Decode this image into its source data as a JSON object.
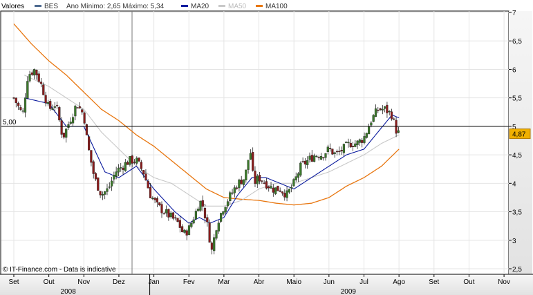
{
  "header": {
    "valores_label": "Valores",
    "symbol": "BES",
    "range_text": "Ano Mínimo: 2,65 Máximo: 5,34",
    "legend": [
      {
        "name": "BES",
        "color": "#4d6a8f"
      },
      {
        "name": "MA20",
        "color": "#0a1a9e"
      },
      {
        "name": "MA50",
        "color": "#c8c8c8"
      },
      {
        "name": "MA100",
        "color": "#e8760f"
      }
    ]
  },
  "footer": {
    "source": "© IT-Finance.com - Data is indicative"
  },
  "chart_data": {
    "type": "candlestick",
    "y_axis": {
      "min": 2.5,
      "max": 7,
      "ticks": [
        "2,5",
        "3",
        "3,5",
        "4",
        "4,5",
        "5",
        "5,5",
        "6",
        "6,5",
        "7"
      ],
      "position": "right"
    },
    "x_axis": {
      "months": [
        "Sep",
        "Oct",
        "Nov",
        "Dec",
        "Jan",
        "Feb",
        "Mar",
        "Apr",
        "May",
        "Jun",
        "Jul",
        "Aug",
        "Sep",
        "Oct",
        "Nov"
      ],
      "month_labels": [
        "Set",
        "Out",
        "Nov",
        "Dez",
        "Jan",
        "Fev",
        "Mar",
        "Abr",
        "Maio",
        "Jun",
        "Jul",
        "Ago",
        "Set",
        "Out",
        "Nov"
      ],
      "year_labels": [
        {
          "text": "2008",
          "month_index": 1
        },
        {
          "text": "2009",
          "month_index": 9
        }
      ]
    },
    "reference_line": {
      "value": 5.0,
      "label": "5,00"
    },
    "last_value": {
      "value": 4.87,
      "label": "4,87"
    },
    "candle_colors": {
      "up": "#3b7a2a",
      "down": "#8a1c1c"
    },
    "price_anchors": [
      [
        0.0,
        5.5
      ],
      [
        0.25,
        5.2
      ],
      [
        0.4,
        5.9
      ],
      [
        0.6,
        6.0
      ],
      [
        0.8,
        5.7
      ],
      [
        1.0,
        5.3
      ],
      [
        1.2,
        5.4
      ],
      [
        1.4,
        4.8
      ],
      [
        1.6,
        5.1
      ],
      [
        1.8,
        5.4
      ],
      [
        2.0,
        5.2
      ],
      [
        2.1,
        4.7
      ],
      [
        2.3,
        4.1
      ],
      [
        2.5,
        3.8
      ],
      [
        2.7,
        3.9
      ],
      [
        2.9,
        4.2
      ],
      [
        3.1,
        4.3
      ],
      [
        3.3,
        4.4
      ],
      [
        3.5,
        4.4
      ],
      [
        3.7,
        4.2
      ],
      [
        3.9,
        3.8
      ],
      [
        4.1,
        3.6
      ],
      [
        4.3,
        3.5
      ],
      [
        4.5,
        3.4
      ],
      [
        4.7,
        3.3
      ],
      [
        4.85,
        3.1
      ],
      [
        5.0,
        3.2
      ],
      [
        5.2,
        3.5
      ],
      [
        5.3,
        3.7
      ],
      [
        5.4,
        3.6
      ],
      [
        5.55,
        3.2
      ],
      [
        5.65,
        2.8
      ],
      [
        5.8,
        3.3
      ],
      [
        6.0,
        3.6
      ],
      [
        6.2,
        3.8
      ],
      [
        6.4,
        4.0
      ],
      [
        6.6,
        4.1
      ],
      [
        6.75,
        4.6
      ],
      [
        6.85,
        4.0
      ],
      [
        7.0,
        4.1
      ],
      [
        7.2,
        4.0
      ],
      [
        7.4,
        3.9
      ],
      [
        7.6,
        3.9
      ],
      [
        7.8,
        3.8
      ],
      [
        8.0,
        4.0
      ],
      [
        8.2,
        4.3
      ],
      [
        8.4,
        4.4
      ],
      [
        8.6,
        4.5
      ],
      [
        8.8,
        4.5
      ],
      [
        9.0,
        4.6
      ],
      [
        9.2,
        4.5
      ],
      [
        9.4,
        4.6
      ],
      [
        9.6,
        4.7
      ],
      [
        9.8,
        4.7
      ],
      [
        10.0,
        4.8
      ],
      [
        10.2,
        5.1
      ],
      [
        10.4,
        5.3
      ],
      [
        10.6,
        5.3
      ],
      [
        10.8,
        5.2
      ],
      [
        10.9,
        4.95
      ],
      [
        11.0,
        4.87
      ]
    ],
    "ma20": [
      [
        0.3,
        5.5
      ],
      [
        1.0,
        5.4
      ],
      [
        1.5,
        5.0
      ],
      [
        2.0,
        5.0
      ],
      [
        2.3,
        4.6
      ],
      [
        2.6,
        4.2
      ],
      [
        3.0,
        4.1
      ],
      [
        3.5,
        4.3
      ],
      [
        4.0,
        3.9
      ],
      [
        4.3,
        3.7
      ],
      [
        4.6,
        3.5
      ],
      [
        5.0,
        3.3
      ],
      [
        5.3,
        3.4
      ],
      [
        5.6,
        3.3
      ],
      [
        6.0,
        3.4
      ],
      [
        6.4,
        3.8
      ],
      [
        6.8,
        4.1
      ],
      [
        7.2,
        4.1
      ],
      [
        7.6,
        4.0
      ],
      [
        8.0,
        3.9
      ],
      [
        8.5,
        4.1
      ],
      [
        9.0,
        4.3
      ],
      [
        9.5,
        4.5
      ],
      [
        10.0,
        4.6
      ],
      [
        10.4,
        4.9
      ],
      [
        10.8,
        5.2
      ],
      [
        11.0,
        5.15
      ]
    ],
    "ma50": [
      [
        0.3,
        5.9
      ],
      [
        1.0,
        5.7
      ],
      [
        1.5,
        5.5
      ],
      [
        2.0,
        5.3
      ],
      [
        2.5,
        4.9
      ],
      [
        3.0,
        4.6
      ],
      [
        3.5,
        4.3
      ],
      [
        4.0,
        4.1
      ],
      [
        4.5,
        4.0
      ],
      [
        5.0,
        3.8
      ],
      [
        5.5,
        3.6
      ],
      [
        6.0,
        3.6
      ],
      [
        6.5,
        3.7
      ],
      [
        7.0,
        3.9
      ],
      [
        7.5,
        4.0
      ],
      [
        8.0,
        4.0
      ],
      [
        8.5,
        4.1
      ],
      [
        9.0,
        4.2
      ],
      [
        9.5,
        4.35
      ],
      [
        10.0,
        4.5
      ],
      [
        10.5,
        4.7
      ],
      [
        11.0,
        4.85
      ]
    ],
    "ma100": [
      [
        0.0,
        6.8
      ],
      [
        0.5,
        6.45
      ],
      [
        1.0,
        6.15
      ],
      [
        1.5,
        5.9
      ],
      [
        2.0,
        5.6
      ],
      [
        2.5,
        5.3
      ],
      [
        3.0,
        5.1
      ],
      [
        3.5,
        4.85
      ],
      [
        4.0,
        4.65
      ],
      [
        4.5,
        4.4
      ],
      [
        5.0,
        4.15
      ],
      [
        5.5,
        3.9
      ],
      [
        6.0,
        3.75
      ],
      [
        6.5,
        3.72
      ],
      [
        7.0,
        3.7
      ],
      [
        7.5,
        3.65
      ],
      [
        8.0,
        3.62
      ],
      [
        8.5,
        3.65
      ],
      [
        9.0,
        3.75
      ],
      [
        9.5,
        3.95
      ],
      [
        10.0,
        4.1
      ],
      [
        10.5,
        4.3
      ],
      [
        11.0,
        4.6
      ]
    ]
  }
}
